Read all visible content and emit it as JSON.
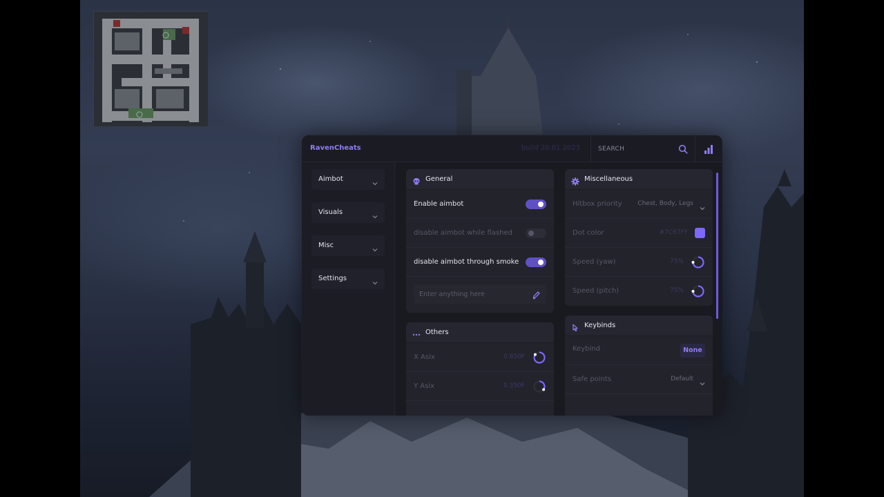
{
  "app": {
    "brand": "RavenCheats",
    "build": "build 20.01.2023"
  },
  "search": {
    "placeholder": "SEARCH"
  },
  "colors": {
    "accent": "#7C67FF",
    "panel": "#1C1D24",
    "card": "#22232B"
  },
  "sidebar": {
    "items": [
      {
        "label": "Aimbot"
      },
      {
        "label": "Visuals"
      },
      {
        "label": "Misc"
      },
      {
        "label": "Settings"
      }
    ]
  },
  "general": {
    "title": "General",
    "rows": [
      {
        "label": "Enable aimbot",
        "enabled": true
      },
      {
        "label": "disable aimbot while flashed",
        "enabled": false
      },
      {
        "label": "disable aimbot through smoke",
        "enabled": true
      }
    ],
    "input_placeholder": "Enter anything here"
  },
  "others": {
    "title": "Others",
    "rows": [
      {
        "label": "X Asix",
        "value": "0.850F",
        "fraction": 0.85
      },
      {
        "label": "Y Asix",
        "value": "0.350F",
        "fraction": 0.35
      }
    ]
  },
  "misc": {
    "title": "Miscellaneous",
    "hitbox": {
      "label": "Hitbox priority",
      "value": "Chest, Body, Legs"
    },
    "dot_color": {
      "label": "Dot color",
      "value": "#7C67FF"
    },
    "speed_yaw": {
      "label": "Speed (yaw)",
      "value": "75%",
      "fraction": 0.75
    },
    "speed_pitch": {
      "label": "Speed (pitch)",
      "value": "75%",
      "fraction": 0.75
    }
  },
  "keybinds": {
    "title": "Keybinds",
    "keybind": {
      "label": "Keybind",
      "value": "None"
    },
    "safe_points": {
      "label": "Safe points",
      "value": "Default"
    }
  }
}
